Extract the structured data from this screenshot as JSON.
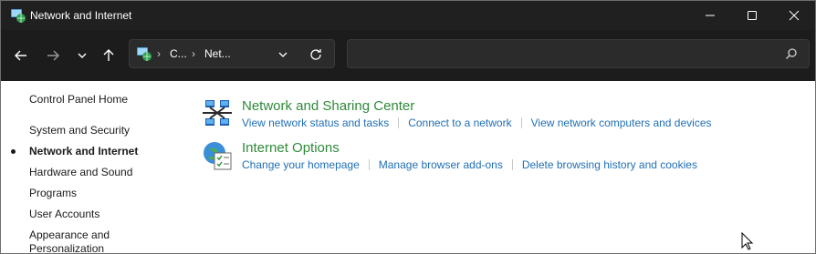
{
  "window": {
    "title": "Network and Internet",
    "icon": "network-globe-icon",
    "controls": [
      "minimize-icon",
      "maximize-icon",
      "close-icon"
    ]
  },
  "navigation": {
    "address": {
      "segments": [
        "C...",
        "Net..."
      ]
    },
    "search": {
      "placeholder": ""
    }
  },
  "sidebar": {
    "home_label": "Control Panel Home",
    "items": [
      {
        "label": "System and Security",
        "active": false
      },
      {
        "label": "Network and Internet",
        "active": true
      },
      {
        "label": "Hardware and Sound",
        "active": false
      },
      {
        "label": "Programs",
        "active": false
      },
      {
        "label": "User Accounts",
        "active": false
      },
      {
        "label": "Appearance and Personalization",
        "active": false
      }
    ]
  },
  "categories": [
    {
      "title": "Network and Sharing Center",
      "icon": "network-sharing-icon",
      "links": [
        "View network status and tasks",
        "Connect to a network",
        "View network computers and devices"
      ]
    },
    {
      "title": "Internet Options",
      "icon": "internet-options-icon",
      "links": [
        "Change your homepage",
        "Manage browser add-ons",
        "Delete browsing history and cookies"
      ]
    }
  ],
  "colors": {
    "titlebar": "#202020",
    "navbar": "#1c1c1c",
    "category_title": "#2e8b3a",
    "link": "#1f6fb5"
  }
}
